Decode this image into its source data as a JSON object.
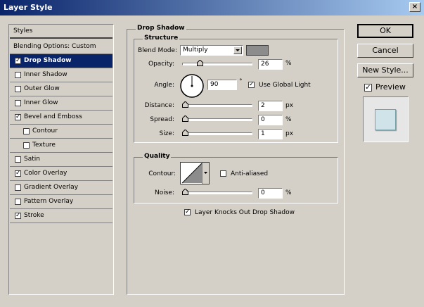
{
  "window": {
    "title": "Layer Style",
    "close_glyph": "×"
  },
  "left_panel": {
    "styles_header": "Styles",
    "blending": "Blending Options: Custom",
    "items": [
      {
        "label": "Drop Shadow",
        "checked": true,
        "selected": true,
        "sub": false
      },
      {
        "label": "Inner Shadow",
        "checked": false,
        "selected": false,
        "sub": false
      },
      {
        "label": "Outer Glow",
        "checked": false,
        "selected": false,
        "sub": false
      },
      {
        "label": "Inner Glow",
        "checked": false,
        "selected": false,
        "sub": false
      },
      {
        "label": "Bevel and Emboss",
        "checked": true,
        "selected": false,
        "sub": false
      },
      {
        "label": "Contour",
        "checked": false,
        "selected": false,
        "sub": true
      },
      {
        "label": "Texture",
        "checked": false,
        "selected": false,
        "sub": true
      },
      {
        "label": "Satin",
        "checked": false,
        "selected": false,
        "sub": false
      },
      {
        "label": "Color Overlay",
        "checked": true,
        "selected": false,
        "sub": false
      },
      {
        "label": "Gradient Overlay",
        "checked": false,
        "selected": false,
        "sub": false
      },
      {
        "label": "Pattern Overlay",
        "checked": false,
        "selected": false,
        "sub": false
      },
      {
        "label": "Stroke",
        "checked": true,
        "selected": false,
        "sub": false
      }
    ]
  },
  "drop_shadow": {
    "group_title": "Drop Shadow",
    "structure": {
      "title": "Structure",
      "blend_mode_label": "Blend Mode:",
      "blend_mode_value": "Multiply",
      "shadow_color": "#8c8c8c",
      "opacity_label": "Opacity:",
      "opacity_value": "26",
      "opacity_unit": "%",
      "opacity_fraction": 0.26,
      "angle_label": "Angle:",
      "angle_value": "90",
      "angle_unit": "°",
      "use_global_light_label": "Use Global Light",
      "use_global_light": true,
      "distance_label": "Distance:",
      "distance_value": "2",
      "distance_unit": "px",
      "spread_label": "Spread:",
      "spread_value": "0",
      "spread_unit": "%",
      "size_label": "Size:",
      "size_value": "1",
      "size_unit": "px"
    },
    "quality": {
      "title": "Quality",
      "contour_label": "Contour:",
      "anti_aliased_label": "Anti-aliased",
      "anti_aliased": false,
      "noise_label": "Noise:",
      "noise_value": "0",
      "noise_unit": "%"
    },
    "knockout_label": "Layer Knocks Out Drop Shadow",
    "knockout": true
  },
  "buttons": {
    "ok": "OK",
    "cancel": "Cancel",
    "new_style": "New Style..."
  },
  "preview": {
    "label": "Preview",
    "checked": true,
    "swatch_color": "#cfe3e8"
  },
  "check_glyph": "✓"
}
